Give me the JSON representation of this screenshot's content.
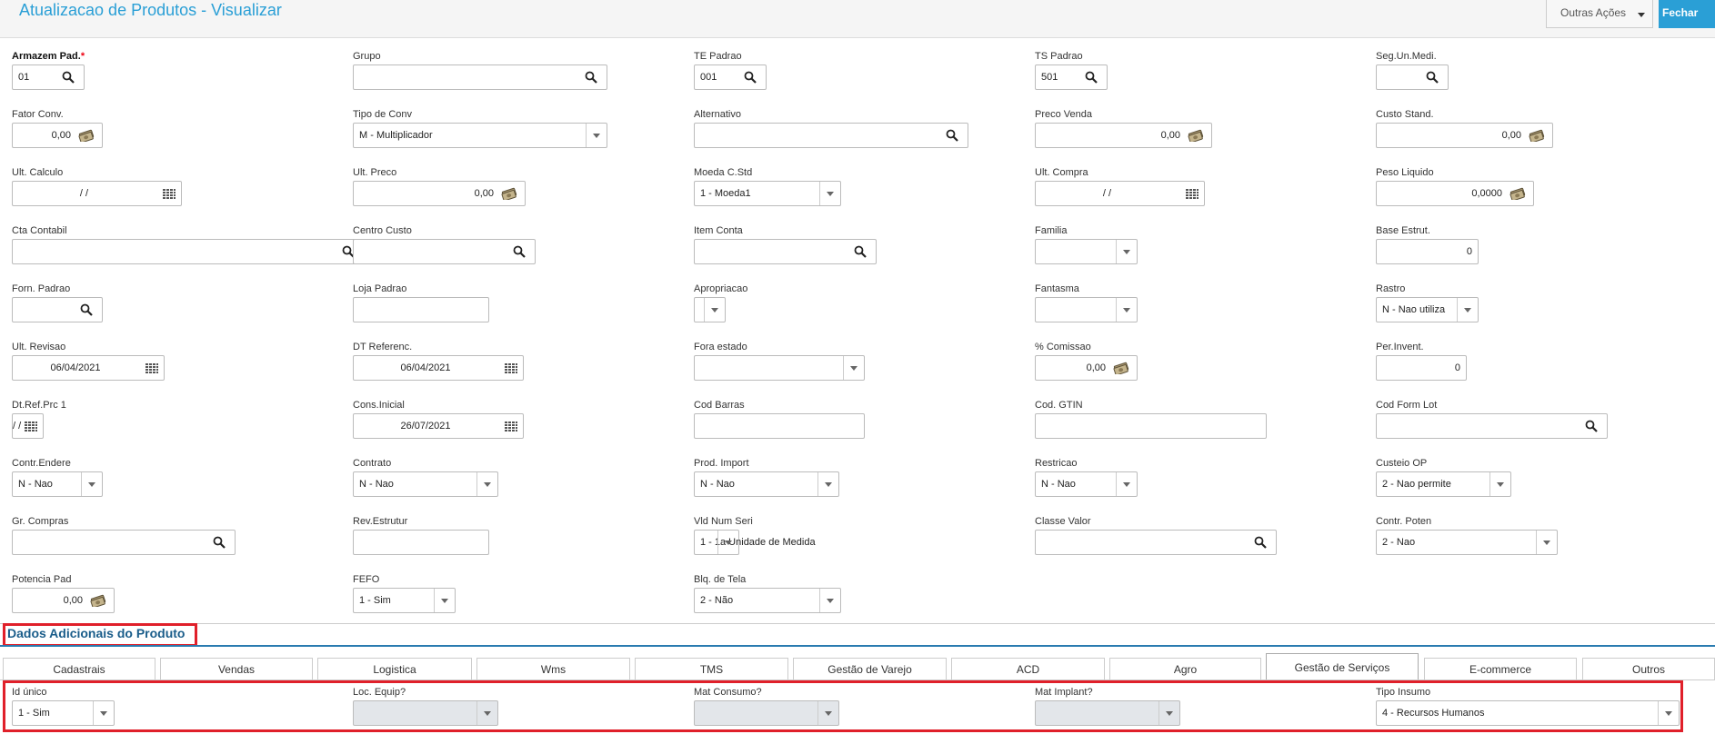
{
  "header": {
    "title": "Atualizacao de Produtos - Visualizar",
    "outras_acoes": "Outras Ações",
    "fechar": "Fechar"
  },
  "fields": [
    {
      "label": "Armazem Pad.",
      "required": true,
      "value": "01",
      "kind": "search"
    },
    {
      "label": "Grupo",
      "value": "",
      "kind": "search"
    },
    {
      "label": "TE Padrao",
      "value": "001",
      "kind": "search"
    },
    {
      "label": "TS Padrao",
      "value": "501",
      "kind": "search"
    },
    {
      "label": "Seg.Un.Medi.",
      "value": "",
      "kind": "search"
    },
    {
      "label": "Fator Conv.",
      "value": "0,00",
      "kind": "money"
    },
    {
      "label": "Tipo de Conv",
      "value": "M - Multiplicador",
      "kind": "select"
    },
    {
      "label": "Alternativo",
      "value": "",
      "kind": "search"
    },
    {
      "label": "Preco Venda",
      "value": "0,00",
      "kind": "money"
    },
    {
      "label": "Custo Stand.",
      "value": "0,00",
      "kind": "money"
    },
    {
      "label": "Ult. Calculo",
      "value": "/ /",
      "kind": "date"
    },
    {
      "label": "Ult. Preco",
      "value": "0,00",
      "kind": "money"
    },
    {
      "label": "Moeda C.Std",
      "value": "1 - Moeda1",
      "kind": "select"
    },
    {
      "label": "Ult. Compra",
      "value": "/ /",
      "kind": "date"
    },
    {
      "label": "Peso Liquido",
      "value": "0,0000",
      "kind": "money"
    },
    {
      "label": "Cta Contabil",
      "value": "",
      "kind": "search"
    },
    {
      "label": "Centro Custo",
      "value": "",
      "kind": "search"
    },
    {
      "label": "Item Conta",
      "value": "",
      "kind": "search"
    },
    {
      "label": "Familia",
      "value": "",
      "kind": "select"
    },
    {
      "label": "Base Estrut.",
      "value": "0",
      "kind": "number"
    },
    {
      "label": "Forn. Padrao",
      "value": "",
      "kind": "search"
    },
    {
      "label": "Loja Padrao",
      "value": "",
      "kind": "text"
    },
    {
      "label": "Apropriacao",
      "value": "",
      "kind": "select"
    },
    {
      "label": "Fantasma",
      "value": "",
      "kind": "select"
    },
    {
      "label": "Rastro",
      "value": "N - Nao utiliza",
      "kind": "select"
    },
    {
      "label": "Ult. Revisao",
      "value": "06/04/2021",
      "kind": "date"
    },
    {
      "label": "DT Referenc.",
      "value": "06/04/2021",
      "kind": "date"
    },
    {
      "label": "Fora estado",
      "value": "",
      "kind": "select"
    },
    {
      "label": "% Comissao",
      "value": "0,00",
      "kind": "money"
    },
    {
      "label": "Per.Invent.",
      "value": "0",
      "kind": "number"
    },
    {
      "label": "Dt.Ref.Prc 1",
      "value": "/ /",
      "kind": "date"
    },
    {
      "label": "Cons.Inicial",
      "value": "26/07/2021",
      "kind": "date"
    },
    {
      "label": "Cod Barras",
      "value": "",
      "kind": "text"
    },
    {
      "label": "Cod. GTIN",
      "value": "",
      "kind": "text"
    },
    {
      "label": "Cod Form Lot",
      "value": "",
      "kind": "search"
    },
    {
      "label": "Contr.Endere",
      "value": "N - Nao",
      "kind": "select"
    },
    {
      "label": "Contrato",
      "value": "N - Nao",
      "kind": "select"
    },
    {
      "label": "Prod. Import",
      "value": "N - Nao",
      "kind": "select"
    },
    {
      "label": "Restricao",
      "value": "N - Nao",
      "kind": "select"
    },
    {
      "label": "Custeio OP",
      "value": "2 - Nao permite",
      "kind": "select"
    },
    {
      "label": "Gr. Compras",
      "value": "",
      "kind": "search"
    },
    {
      "label": "Rev.Estrutur",
      "value": "",
      "kind": "text"
    },
    {
      "label": "Vld Num Seri",
      "value": "1 - 1a Unidade de Medida",
      "kind": "select"
    },
    {
      "label": "Classe Valor",
      "value": "",
      "kind": "search"
    },
    {
      "label": "Contr. Poten",
      "value": "2 - Nao",
      "kind": "select"
    },
    {
      "label": "Potencia Pad",
      "value": "0,00",
      "kind": "money"
    },
    {
      "label": "FEFO",
      "value": "1 - Sim",
      "kind": "select"
    },
    {
      "label": "Blq. de Tela",
      "value": "2 - Não",
      "kind": "select"
    }
  ],
  "section": {
    "title": "Dados Adicionais do Produto",
    "tabs": [
      "Cadastrais",
      "Vendas",
      "Logistica",
      "Wms",
      "TMS",
      "Gestão de Varejo",
      "ACD",
      "Agro",
      "Gestão de Serviços",
      "E-commerce",
      "Outros"
    ],
    "active_tab": "Gestão de Serviços"
  },
  "tab_fields": [
    {
      "label": "Id único",
      "value": "1 - Sim",
      "kind": "select",
      "disabled": false
    },
    {
      "label": "Loc. Equip?",
      "value": "",
      "kind": "select",
      "disabled": true
    },
    {
      "label": "Mat Consumo?",
      "value": "",
      "kind": "select",
      "disabled": true
    },
    {
      "label": "Mat Implant?",
      "value": "",
      "kind": "select",
      "disabled": true
    },
    {
      "label": "Tipo Insumo",
      "value": "4 - Recursos Humanos",
      "kind": "select",
      "disabled": false
    }
  ],
  "colors": {
    "accent": "#2a9fd6",
    "highlight": "#e0202a",
    "section_title": "#1a5d8a"
  }
}
